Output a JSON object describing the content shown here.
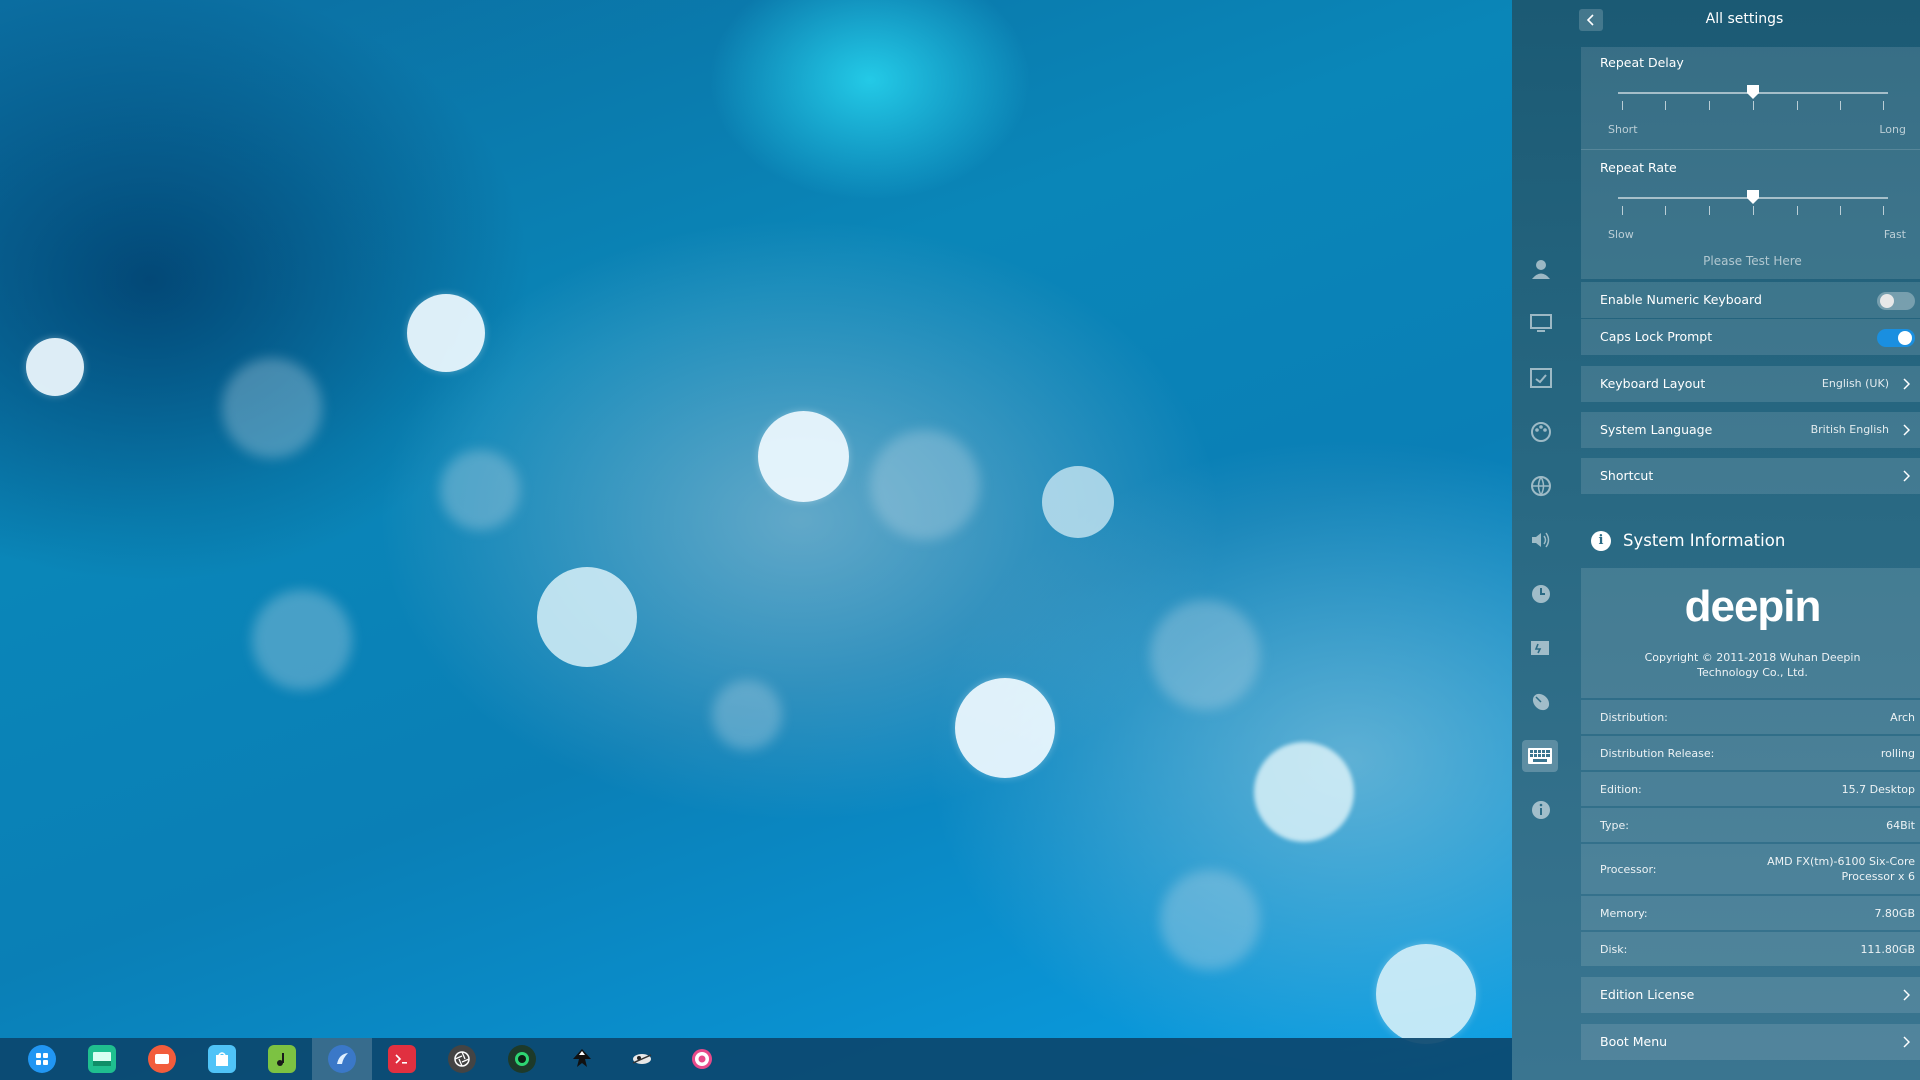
{
  "header": {
    "title": "All settings"
  },
  "keyboard": {
    "repeat_delay": {
      "label": "Repeat Delay",
      "min_label": "Short",
      "max_label": "Long",
      "value": 0.5
    },
    "repeat_rate": {
      "label": "Repeat Rate",
      "min_label": "Slow",
      "max_label": "Fast",
      "value": 0.5
    },
    "test_placeholder": "Please Test Here",
    "numeric_keyboard": {
      "label": "Enable Numeric Keyboard",
      "enabled": false
    },
    "caps_lock": {
      "label": "Caps Lock Prompt",
      "enabled": true
    },
    "layout": {
      "label": "Keyboard Layout",
      "value": "English (UK)"
    },
    "language": {
      "label": "System Language",
      "value": "British English"
    },
    "shortcut": {
      "label": "Shortcut"
    }
  },
  "system_info": {
    "title": "System Information",
    "logo_text": "deepin",
    "copyright_line1": "Copyright © 2011-2018 Wuhan Deepin",
    "copyright_line2": "Technology Co., Ltd.",
    "rows": [
      {
        "key": "Distribution:",
        "value": "Arch"
      },
      {
        "key": "Distribution Release:",
        "value": "rolling"
      },
      {
        "key": "Edition:",
        "value": "15.7 Desktop"
      },
      {
        "key": "Type:",
        "value": "64Bit"
      },
      {
        "key": "Processor:",
        "value": "AMD FX(tm)-6100 Six-Core",
        "value2": "Processor x 6"
      },
      {
        "key": "Memory:",
        "value": "7.80GB"
      },
      {
        "key": "Disk:",
        "value": "111.80GB"
      }
    ],
    "edition_license": "Edition License",
    "boot_menu": "Boot Menu"
  },
  "sidebar_icons": [
    "user-icon",
    "display-icon",
    "default-apps-icon",
    "personalization-icon",
    "network-icon",
    "sound-icon",
    "time-icon",
    "power-icon",
    "mouse-icon",
    "keyboard-icon",
    "info-icon"
  ],
  "taskbar_icons": [
    "launcher-icon",
    "file-manager-icon",
    "screen-recorder-icon",
    "app-store-icon",
    "music-icon",
    "browser-icon",
    "terminal-icon",
    "aperture-icon",
    "camera-icon",
    "inkscape-icon",
    "pen-icon",
    "settings-icon"
  ],
  "colors": {
    "accent": "#1a8fe0",
    "panel_bg": "#2a6a84",
    "desktop_bg": "#0a86b8"
  }
}
